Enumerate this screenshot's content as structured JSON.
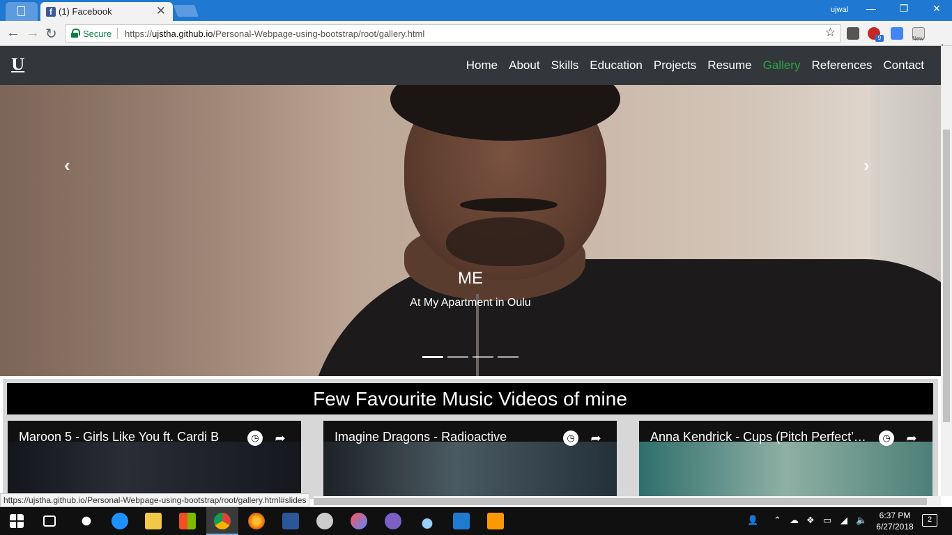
{
  "browser": {
    "tab_title": "(1) Facebook",
    "tab_favicon": "f",
    "tab_close": "✕",
    "user": "ujwal",
    "win_minimize": "—",
    "win_restore": "❐",
    "win_close": "✕",
    "back": "←",
    "forward": "→",
    "reload": "↻",
    "secure_label": "Secure",
    "url_scheme": "https://",
    "url_host": "ujstha.github.io",
    "url_path": "/Personal-Webpage-using-bootstrap/root/gallery.html",
    "star": "☆",
    "ext_badge": "9",
    "ext_new": "New",
    "menu": "⋮"
  },
  "site": {
    "brand": "U",
    "nav": [
      "Home",
      "About",
      "Skills",
      "Education",
      "Projects",
      "Resume",
      "Gallery",
      "References",
      "Contact"
    ],
    "active_nav": "Gallery",
    "active_color": "#28a745"
  },
  "carousel": {
    "prev": "‹",
    "next": "›",
    "caption_title": "ME",
    "caption_text": "At My Apartment in Oulu",
    "slide_count": 4,
    "active_index": 0
  },
  "music": {
    "heading": "Few Favourite Music Videos of mine",
    "videos": [
      {
        "title": "Maroon 5 - Girls Like You ft. Cardi B"
      },
      {
        "title": "Imagine Dragons - Radioactive"
      },
      {
        "title": "Anna Kendrick - Cups (Pitch Perfect’s “When I’m Gone”)"
      }
    ],
    "clock_icon": "◷",
    "share_icon": "➦"
  },
  "status_url": "https://ujstha.github.io/Personal-Webpage-using-bootstrap/root/gallery.html#slides",
  "taskbar": {
    "time": "6:37 PM",
    "date": "6/27/2018",
    "notifications": "2"
  }
}
